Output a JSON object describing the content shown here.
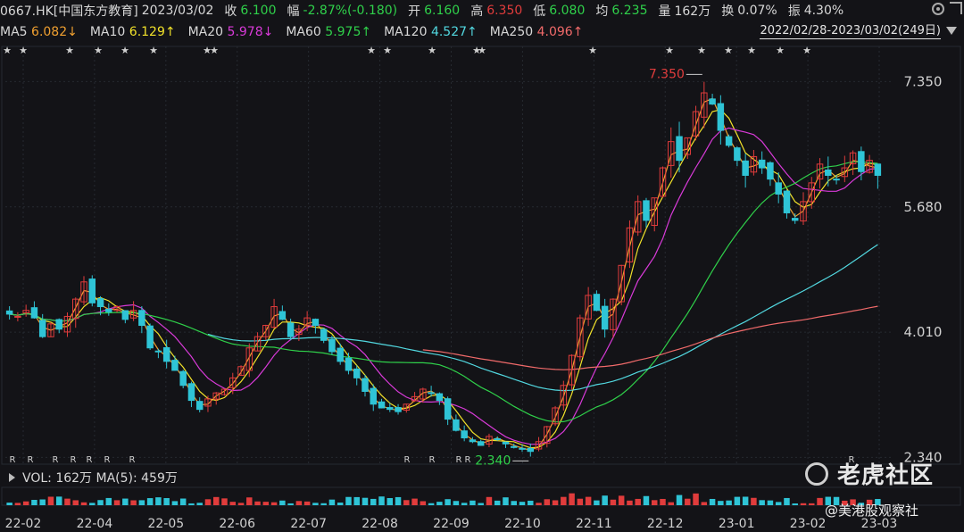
{
  "header": {
    "code": "0667.HK[中国东方教育]",
    "date": "2023/03/02",
    "close_label": "收",
    "close": "6.100",
    "change_label": "幅",
    "change": "-2.87%(-0.180)",
    "open_label": "开",
    "open": "6.160",
    "high_label": "高",
    "high": "6.350",
    "low_label": "低",
    "low": "6.080",
    "avg_label": "均",
    "avg": "6.235",
    "volume_label": "量",
    "volume": "162万",
    "turnover_label": "换",
    "turnover": "0.07%",
    "amplitude_label": "振",
    "amplitude": "4.30%"
  },
  "ma_bar": {
    "items": [
      {
        "label": "MA5",
        "value": "6.082↓",
        "color": "#f0a030"
      },
      {
        "label": "MA10",
        "value": "6.129↑",
        "color": "#f2e22a"
      },
      {
        "label": "MA20",
        "value": "5.978↓",
        "color": "#d83ad8"
      },
      {
        "label": "MA60",
        "value": "5.975↑",
        "color": "#2fd04a"
      },
      {
        "label": "MA120",
        "value": "4.527↑",
        "color": "#52d8e0"
      },
      {
        "label": "MA250",
        "value": "4.096↑",
        "color": "#f06a6a"
      }
    ],
    "range": "2022/02/28-2023/03/02(249日)"
  },
  "volume_bar": {
    "text": "VOL: 162万  MA(5): 459万"
  },
  "watermark": {
    "text": "老虎社区",
    "source": "@美港股观察社"
  },
  "colors": {
    "up": "#e03c3c",
    "down": "#2fc4d6",
    "background": "#131317",
    "grid": "#262a30"
  },
  "chart_data": {
    "type": "candlestick",
    "ticker": "0667.HK",
    "y_ticks": [
      "7.350",
      "5.680",
      "4.010",
      "2.340"
    ],
    "ylim": [
      2.25,
      7.7
    ],
    "x_ticks": [
      "22-02",
      "22-04",
      "22-05",
      "22-06",
      "22-07",
      "22-08",
      "22-09",
      "22-10",
      "22-11",
      "22-12",
      "23-01",
      "23-02",
      "23-03"
    ],
    "annotations": [
      {
        "text": "7.350",
        "date": "2023-01-04",
        "value": 7.35
      },
      {
        "text": "2.340",
        "date": "2022-10-25",
        "value": 2.34
      }
    ],
    "close_series": [
      4.25,
      4.22,
      4.3,
      4.2,
      3.95,
      4.12,
      4.05,
      4.22,
      4.45,
      4.68,
      4.4,
      4.35,
      4.28,
      4.35,
      4.18,
      4.3,
      4.1,
      3.8,
      3.75,
      3.62,
      3.5,
      3.3,
      3.1,
      2.98,
      3.12,
      3.2,
      3.25,
      3.4,
      3.55,
      3.8,
      3.95,
      4.1,
      4.35,
      4.18,
      3.95,
      4.05,
      4.2,
      4.1,
      3.9,
      3.75,
      3.62,
      3.5,
      3.4,
      3.22,
      3.05,
      3.0,
      2.98,
      2.95,
      3.05,
      3.15,
      3.25,
      3.2,
      3.1,
      2.85,
      2.7,
      2.6,
      2.55,
      2.5,
      2.62,
      2.58,
      2.52,
      2.48,
      2.45,
      2.42,
      2.55,
      2.75,
      3.0,
      3.3,
      3.7,
      4.2,
      4.5,
      4.3,
      4.05,
      4.45,
      4.9,
      5.4,
      5.75,
      5.5,
      5.8,
      6.2,
      6.55,
      6.3,
      6.6,
      6.95,
      7.2,
      7.05,
      6.7,
      6.5,
      6.3,
      6.1,
      6.35,
      6.2,
      6.05,
      5.85,
      5.6,
      5.5,
      5.75,
      6.0,
      6.25,
      6.1,
      6.05,
      6.2,
      6.4,
      6.15,
      6.3,
      6.1
    ]
  }
}
